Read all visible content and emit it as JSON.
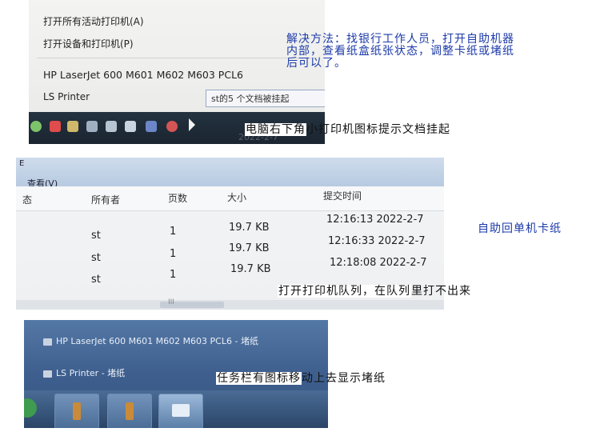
{
  "photo1": {
    "menu_items": [
      "打开所有活动打印机(A)",
      "打开设备和打印机(P)"
    ],
    "printers": [
      "HP LaserJet 600 M601 M602 M603 PCL6",
      "LS Printer"
    ],
    "tooltip": "st的5 个文档被挂起",
    "tray_icons": [
      "shield-icon",
      "flag-icon",
      "network-icon",
      "speaker-icon",
      "volume-icon",
      "printer-icon",
      "update-icon",
      "cursor-icon"
    ],
    "tray_date": "2022-2-7"
  },
  "photo2": {
    "toolbar_title": "E",
    "view_menu": "查看(V)",
    "columns": [
      "态",
      "所有者",
      "页数",
      "大小",
      "提交时间"
    ],
    "rows": [
      {
        "owner": "st",
        "pages": "1",
        "size": "19.7 KB",
        "time": "12:16:13  2022-2-7"
      },
      {
        "owner": "st",
        "pages": "1",
        "size": "19.7 KB",
        "time": "12:16:33  2022-2-7"
      },
      {
        "owner": "st",
        "pages": "1",
        "size": "19.7 KB",
        "time": "12:18:08  2022-2-7"
      }
    ],
    "scroll_marker": "III"
  },
  "photo3": {
    "entries": [
      "HP LaserJet 600 M601 M602 M603 PCL6 - 堵纸",
      "LS Printer - 堵纸"
    ]
  },
  "captions": {
    "solution": [
      "解决方法：找银行工作人员，打开自助机器",
      "内部，查看纸盒纸张状态，调整卡纸或堵纸",
      "后可以了。"
    ],
    "tray_prefix": "电脑右下角",
    "tray_suffix": "小打印机图标提示文档挂起",
    "jam": "自助回单机卡纸",
    "queue_prefix": "打开打印机队列，在队列",
    "queue_suffix": "里打不出来",
    "taskbar_prefix": "任务栏有图标移",
    "taskbar_suffix": "动上去显示堵纸"
  },
  "colors": {
    "caption_blue": "#1c3aa8",
    "caption_black": "#111111"
  }
}
